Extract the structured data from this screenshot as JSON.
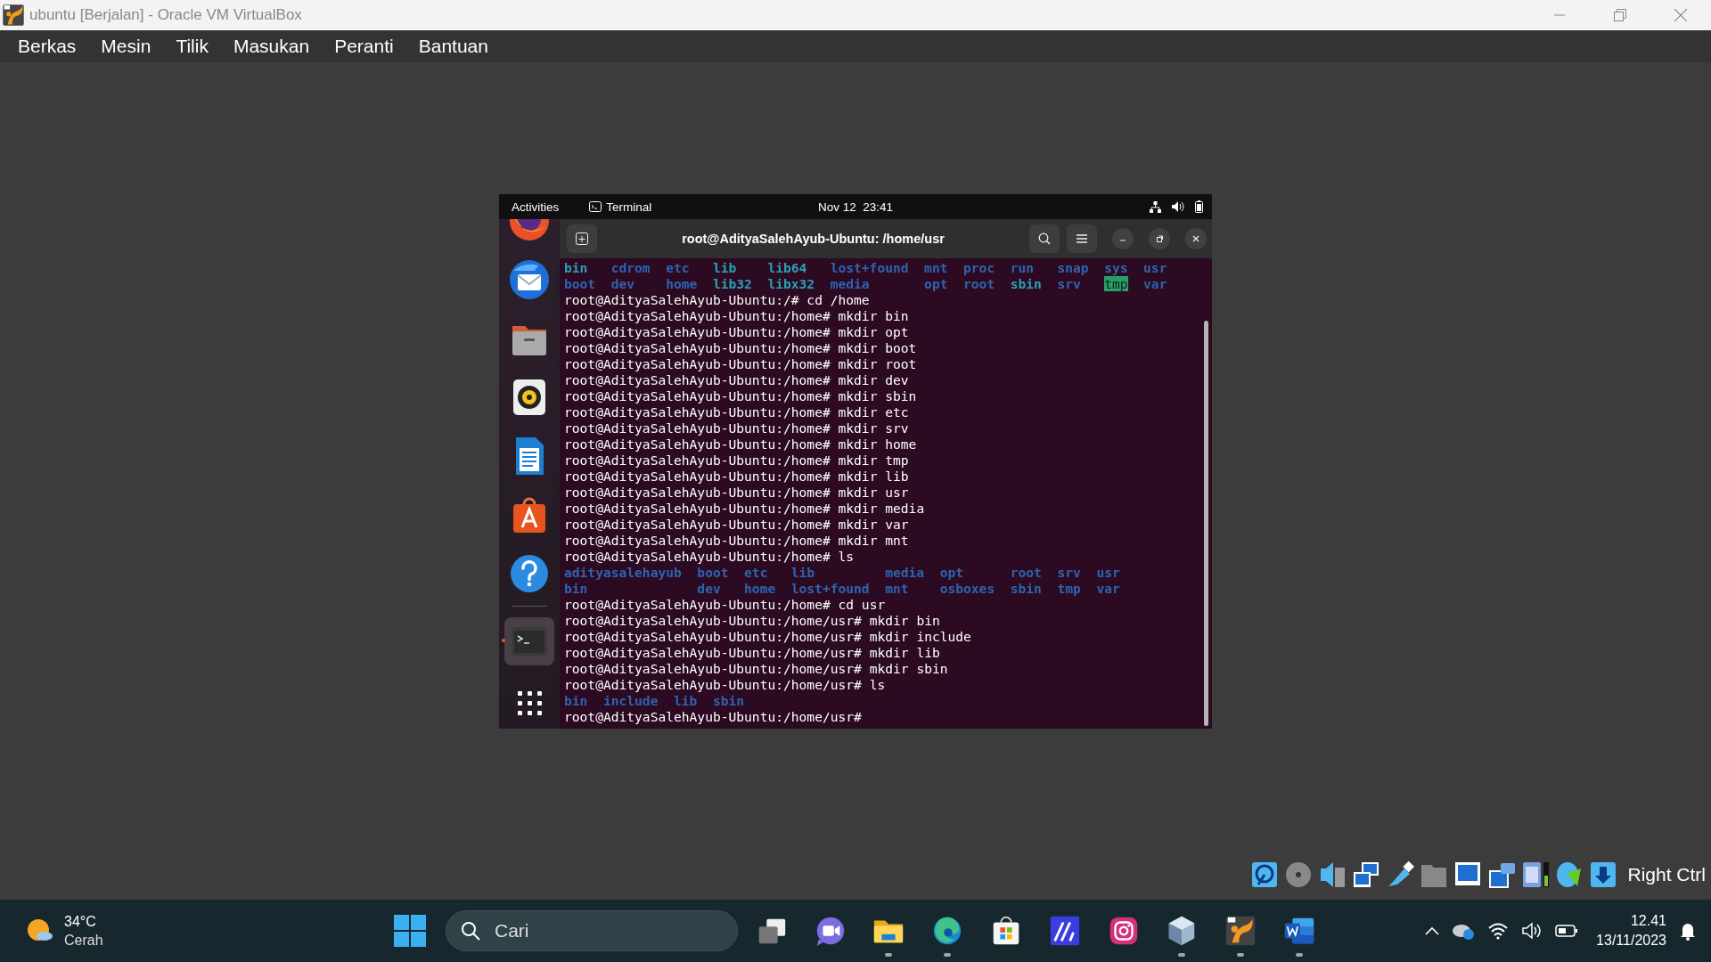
{
  "window": {
    "title": "ubuntu [Berjalan] - Oracle VM VirtualBox"
  },
  "menu": [
    "Berkas",
    "Mesin",
    "Tilik",
    "Masukan",
    "Peranti",
    "Bantuan"
  ],
  "guest": {
    "top_bar": {
      "activities": "Activities",
      "app": "Terminal",
      "clock": "Nov 12  23:41"
    },
    "dock": [
      {
        "kind": "firefox",
        "active": false
      },
      {
        "kind": "thunderbird",
        "active": false
      },
      {
        "kind": "files",
        "active": false
      },
      {
        "kind": "rhythmbox",
        "active": false
      },
      {
        "kind": "writer",
        "active": false
      },
      {
        "kind": "software",
        "active": false
      },
      {
        "kind": "help",
        "active": false
      },
      {
        "kind": "terminal",
        "active": true
      },
      {
        "kind": "apps",
        "active": false
      }
    ],
    "terminal": {
      "title": "root@AdityaSalehAyub-Ubuntu: /home/usr",
      "lines": [
        {
          "kind": "listing",
          "rows": [
            [
              {
                "text": "bin",
                "kind": "link"
              },
              {
                "text": "cdrom",
                "kind": "dir"
              },
              {
                "text": "etc",
                "kind": "dir"
              },
              {
                "text": "lib",
                "kind": "link"
              },
              {
                "text": "lib64",
                "kind": "link"
              },
              {
                "text": "lost+found",
                "kind": "dir"
              },
              {
                "text": "mnt",
                "kind": "dir"
              },
              {
                "text": "proc",
                "kind": "dir"
              },
              {
                "text": "run",
                "kind": "dir"
              },
              {
                "text": "snap",
                "kind": "dir"
              },
              {
                "text": "sys",
                "kind": "dir"
              },
              {
                "text": "usr",
                "kind": "dir"
              }
            ],
            [
              {
                "text": "boot",
                "kind": "dir"
              },
              {
                "text": "dev",
                "kind": "dir"
              },
              {
                "text": "home",
                "kind": "dir"
              },
              {
                "text": "lib32",
                "kind": "link"
              },
              {
                "text": "libx32",
                "kind": "link"
              },
              {
                "text": "media",
                "kind": "dir"
              },
              {
                "text": "opt",
                "kind": "dir"
              },
              {
                "text": "root",
                "kind": "dir"
              },
              {
                "text": "sbin",
                "kind": "link"
              },
              {
                "text": "srv",
                "kind": "dir"
              },
              {
                "text": "tmp",
                "kind": "sticky"
              },
              {
                "text": "var",
                "kind": "dir"
              }
            ]
          ]
        },
        {
          "kind": "command",
          "text": "root@AdityaSalehAyub-Ubuntu:/# cd /home"
        },
        {
          "kind": "command",
          "text": "root@AdityaSalehAyub-Ubuntu:/home# mkdir bin"
        },
        {
          "kind": "command",
          "text": "root@AdityaSalehAyub-Ubuntu:/home# mkdir opt"
        },
        {
          "kind": "command",
          "text": "root@AdityaSalehAyub-Ubuntu:/home# mkdir boot"
        },
        {
          "kind": "command",
          "text": "root@AdityaSalehAyub-Ubuntu:/home# mkdir root"
        },
        {
          "kind": "command",
          "text": "root@AdityaSalehAyub-Ubuntu:/home# mkdir dev"
        },
        {
          "kind": "command",
          "text": "root@AdityaSalehAyub-Ubuntu:/home# mkdir sbin"
        },
        {
          "kind": "command",
          "text": "root@AdityaSalehAyub-Ubuntu:/home# mkdir etc"
        },
        {
          "kind": "command",
          "text": "root@AdityaSalehAyub-Ubuntu:/home# mkdir srv"
        },
        {
          "kind": "command",
          "text": "root@AdityaSalehAyub-Ubuntu:/home# mkdir home"
        },
        {
          "kind": "command",
          "text": "root@AdityaSalehAyub-Ubuntu:/home# mkdir tmp"
        },
        {
          "kind": "command",
          "text": "root@AdityaSalehAyub-Ubuntu:/home# mkdir lib"
        },
        {
          "kind": "command",
          "text": "root@AdityaSalehAyub-Ubuntu:/home# mkdir usr"
        },
        {
          "kind": "command",
          "text": "root@AdityaSalehAyub-Ubuntu:/home# mkdir media"
        },
        {
          "kind": "command",
          "text": "root@AdityaSalehAyub-Ubuntu:/home# mkdir var"
        },
        {
          "kind": "command",
          "text": "root@AdityaSalehAyub-Ubuntu:/home# mkdir mnt"
        },
        {
          "kind": "command",
          "text": "root@AdityaSalehAyub-Ubuntu:/home# ls"
        },
        {
          "kind": "listing",
          "rows": [
            [
              {
                "text": "adityasalehayub",
                "kind": "dir"
              },
              {
                "text": "boot",
                "kind": "dir"
              },
              {
                "text": "etc",
                "kind": "dir"
              },
              {
                "text": "lib",
                "kind": "dir"
              },
              {
                "text": "media",
                "kind": "dir"
              },
              {
                "text": "opt",
                "kind": "dir"
              },
              {
                "text": "root",
                "kind": "dir"
              },
              {
                "text": "srv",
                "kind": "dir"
              },
              {
                "text": "usr",
                "kind": "dir"
              }
            ],
            [
              {
                "text": "bin",
                "kind": "dir"
              },
              {
                "text": "dev",
                "kind": "dir"
              },
              {
                "text": "home",
                "kind": "dir"
              },
              {
                "text": "lost+found",
                "kind": "dir"
              },
              {
                "text": "mnt",
                "kind": "dir"
              },
              {
                "text": "osboxes",
                "kind": "dir"
              },
              {
                "text": "sbin",
                "kind": "dir"
              },
              {
                "text": "tmp",
                "kind": "dir"
              },
              {
                "text": "var",
                "kind": "dir"
              }
            ]
          ]
        },
        {
          "kind": "command",
          "text": "root@AdityaSalehAyub-Ubuntu:/home# cd usr"
        },
        {
          "kind": "command",
          "text": "root@AdityaSalehAyub-Ubuntu:/home/usr# mkdir bin"
        },
        {
          "kind": "command",
          "text": "root@AdityaSalehAyub-Ubuntu:/home/usr# mkdir include"
        },
        {
          "kind": "command",
          "text": "root@AdityaSalehAyub-Ubuntu:/home/usr# mkdir lib"
        },
        {
          "kind": "command",
          "text": "root@AdityaSalehAyub-Ubuntu:/home/usr# mkdir sbin"
        },
        {
          "kind": "command",
          "text": "root@AdityaSalehAyub-Ubuntu:/home/usr# ls"
        },
        {
          "kind": "listing",
          "rows": [
            [
              {
                "text": "bin",
                "kind": "dir"
              },
              {
                "text": "include",
                "kind": "dir"
              },
              {
                "text": "lib",
                "kind": "dir"
              },
              {
                "text": "sbin",
                "kind": "dir"
              }
            ]
          ]
        },
        {
          "kind": "command",
          "text": "root@AdityaSalehAyub-Ubuntu:/home/usr#"
        }
      ]
    }
  },
  "status_bar": {
    "host_key": "Right Ctrl"
  },
  "taskbar": {
    "weather": {
      "temperature": "34°C",
      "condition": "Cerah"
    },
    "search": {
      "placeholder": "Cari"
    },
    "apps": [
      {
        "kind": "taskview",
        "running": false
      },
      {
        "kind": "meet",
        "running": false
      },
      {
        "kind": "explorer",
        "running": true
      },
      {
        "kind": "edge",
        "running": true
      },
      {
        "kind": "store",
        "running": false
      },
      {
        "kind": "markup",
        "running": false
      },
      {
        "kind": "instagram",
        "running": false
      },
      {
        "kind": "vbox",
        "running": true
      },
      {
        "kind": "vbox64",
        "running": true
      },
      {
        "kind": "word",
        "running": true
      }
    ],
    "clock": {
      "time": "12.41",
      "date": "13/11/2023"
    }
  }
}
